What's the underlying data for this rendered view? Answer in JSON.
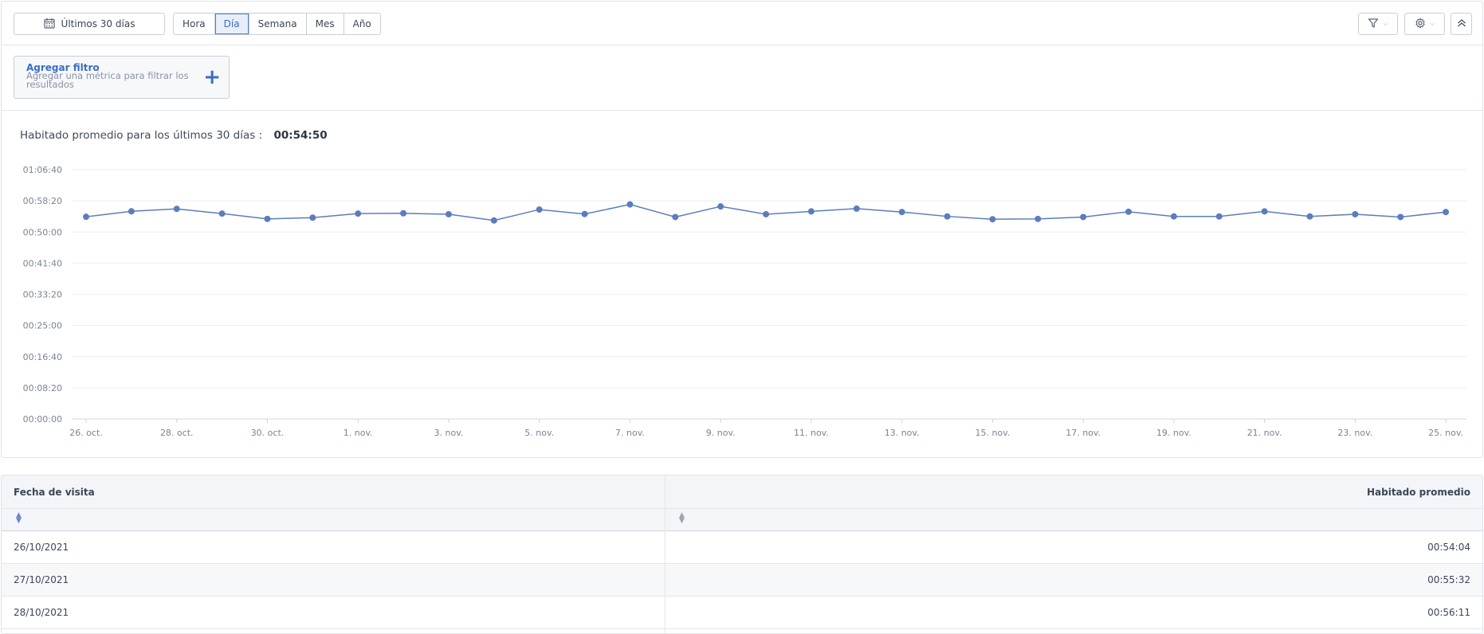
{
  "toolbar": {
    "date_range_label": "Últimos 30 días",
    "periods": [
      {
        "label": "Hora",
        "active": false
      },
      {
        "label": "Día",
        "active": true
      },
      {
        "label": "Semana",
        "active": false
      },
      {
        "label": "Mes",
        "active": false
      },
      {
        "label": "Año",
        "active": false
      }
    ],
    "icons": {
      "date": "calendar-icon",
      "filter": "filter-icon",
      "settings": "gear-icon",
      "collapse": "double-chevron-up-icon",
      "dropdown": "chevron-down-icon"
    }
  },
  "filter": {
    "title": "Agregar filtro",
    "subtitle": "Agregar una métrica para filtrar los resultados",
    "icon": "plus-icon"
  },
  "summary": {
    "label": "Habitado promedio para los últimos 30 días :",
    "value": "00:54:50"
  },
  "chart_data": {
    "type": "line",
    "title": "",
    "xlabel": "",
    "ylabel": "",
    "grid": true,
    "legend": "none",
    "color": "#5b7dbd",
    "y_ticks": [
      "00:00:00",
      "00:08:20",
      "00:16:40",
      "00:25:00",
      "00:33:20",
      "00:41:40",
      "00:50:00",
      "00:58:20",
      "01:06:40"
    ],
    "ylim_seconds": [
      0,
      4000
    ],
    "x_ticks": [
      "26. oct.",
      "28. oct.",
      "30. oct.",
      "1. nov.",
      "3. nov.",
      "5. nov.",
      "7. nov.",
      "9. nov.",
      "11. nov.",
      "13. nov.",
      "15. nov.",
      "17. nov.",
      "19. nov.",
      "21. nov.",
      "23. nov.",
      "25. nov."
    ],
    "x": [
      "26/10/2021",
      "27/10/2021",
      "28/10/2021",
      "29/10/2021",
      "30/10/2021",
      "31/10/2021",
      "01/11/2021",
      "02/11/2021",
      "03/11/2021",
      "04/11/2021",
      "05/11/2021",
      "06/11/2021",
      "07/11/2021",
      "08/11/2021",
      "09/11/2021",
      "10/11/2021",
      "11/11/2021",
      "12/11/2021",
      "13/11/2021",
      "14/11/2021",
      "15/11/2021",
      "16/11/2021",
      "17/11/2021",
      "18/11/2021",
      "19/11/2021",
      "20/11/2021",
      "21/11/2021",
      "22/11/2021",
      "23/11/2021",
      "24/11/2021",
      "25/11/2021"
    ],
    "series": [
      {
        "name": "Habitado promedio",
        "values_seconds": [
          3244,
          3332,
          3371,
          3295,
          3210,
          3230,
          3295,
          3300,
          3285,
          3185,
          3360,
          3288,
          3442,
          3240,
          3410,
          3285,
          3330,
          3375,
          3320,
          3250,
          3205,
          3210,
          3240,
          3325,
          3250,
          3250,
          3330,
          3250,
          3285,
          3240,
          3320
        ]
      }
    ]
  },
  "table": {
    "columns": [
      "Fecha de visita",
      "Habitado promedio"
    ],
    "sort_icon": "sort-arrows-icon",
    "rows": [
      {
        "date": "26/10/2021",
        "value": "00:54:04"
      },
      {
        "date": "27/10/2021",
        "value": "00:55:32"
      },
      {
        "date": "28/10/2021",
        "value": "00:56:11"
      }
    ]
  }
}
